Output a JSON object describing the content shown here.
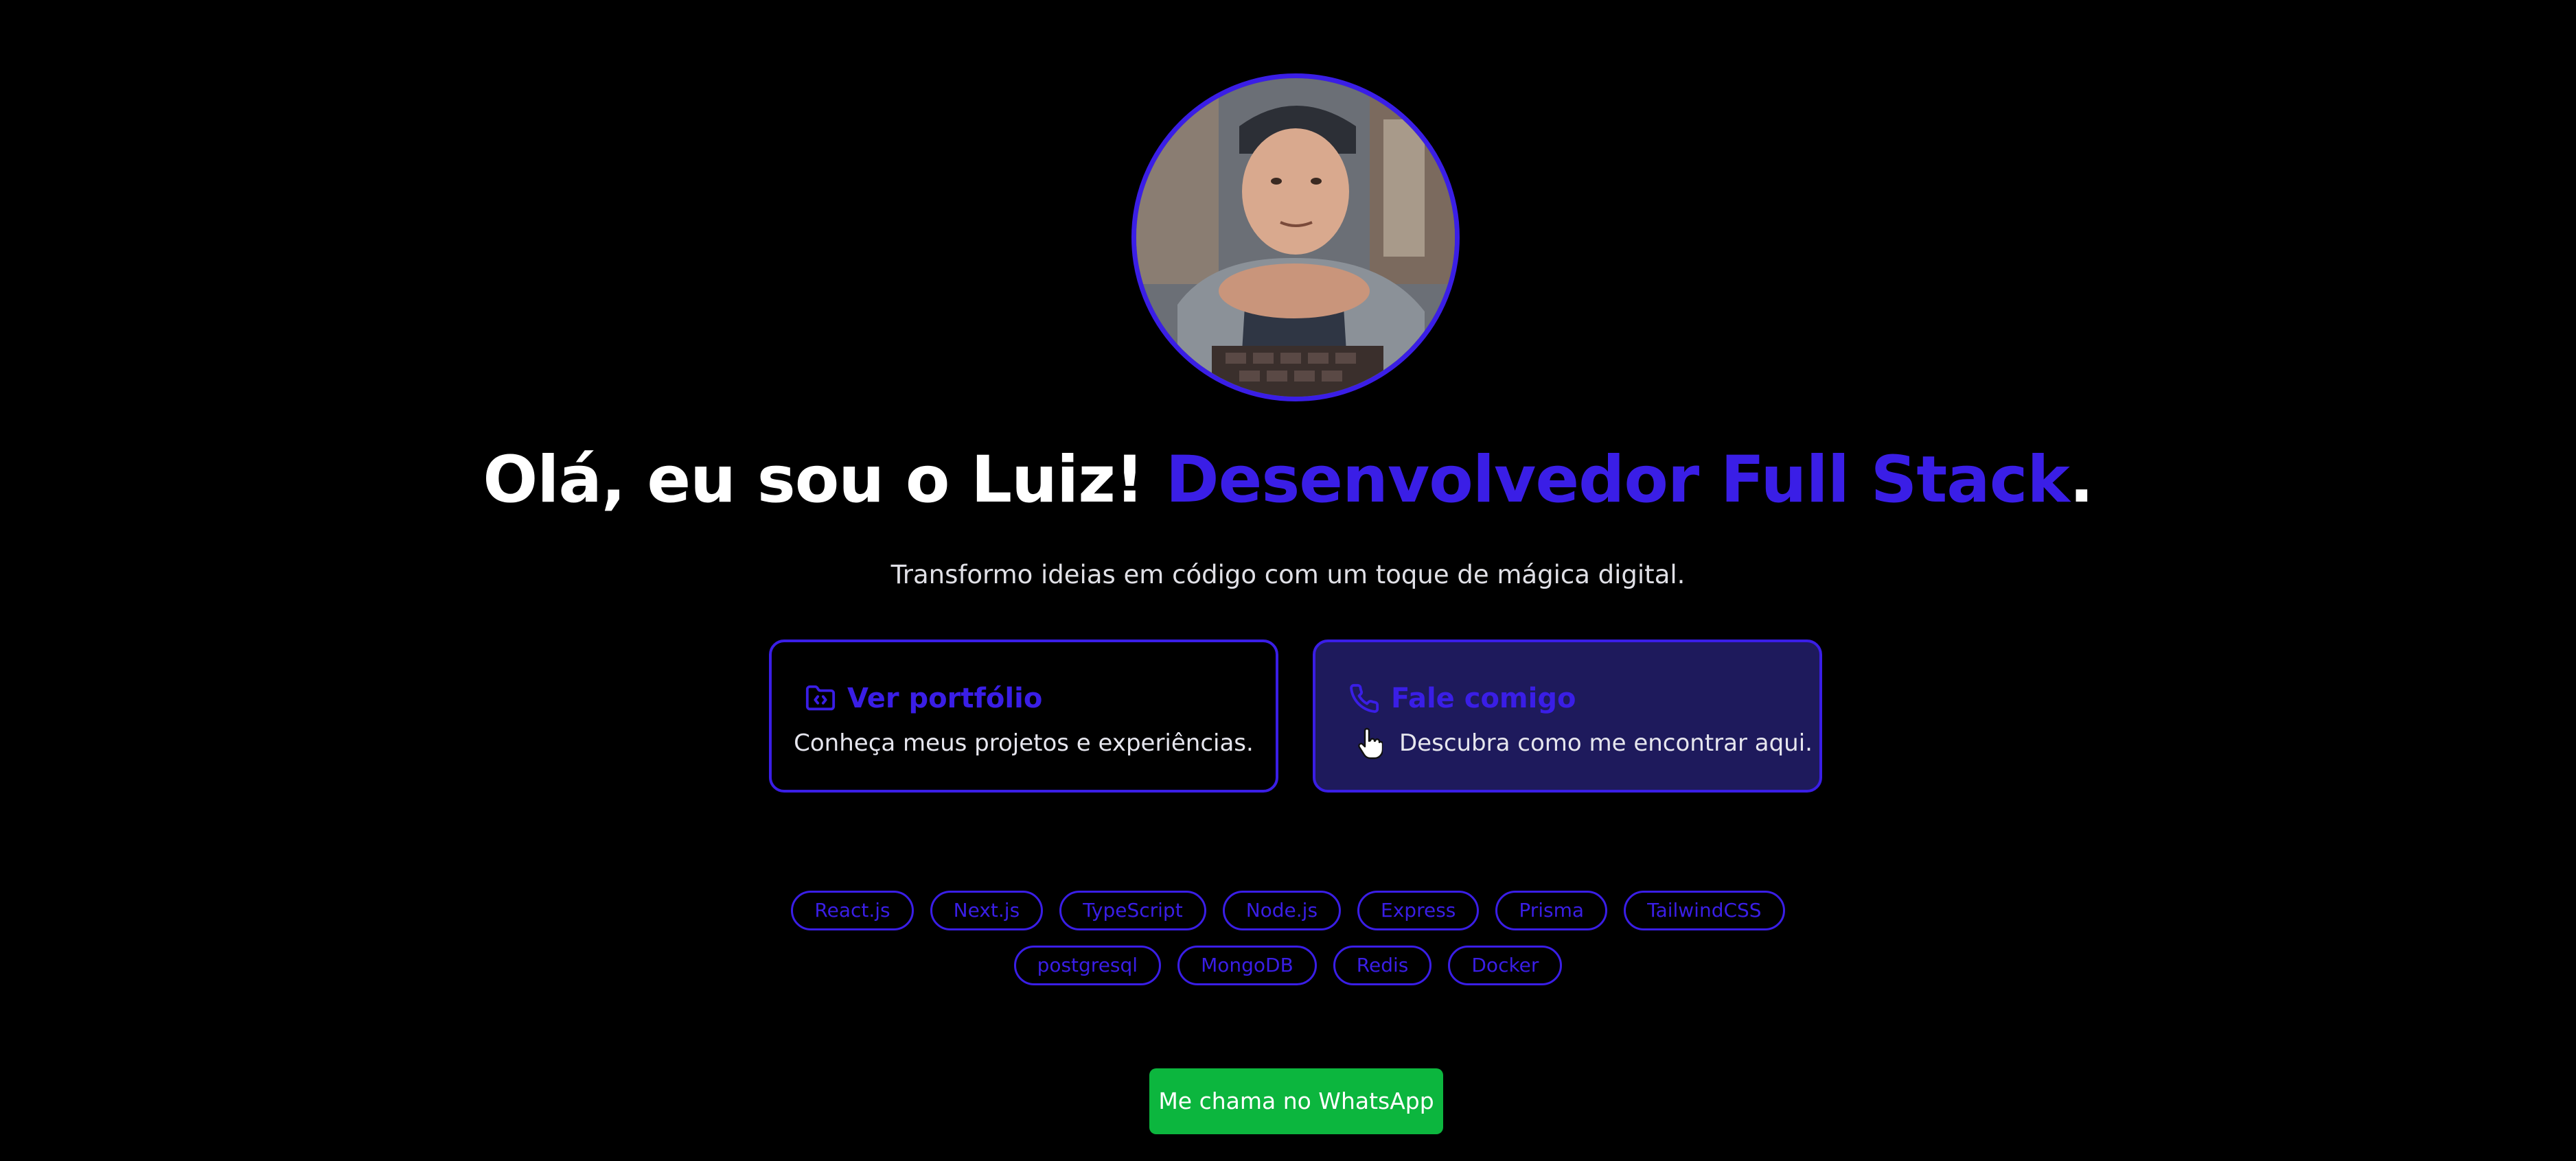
{
  "hero": {
    "greeting": "Olá, eu sou o Luiz! ",
    "role": "Desenvolvedor Full Stack",
    "period": ".",
    "subtitle": "Transformo ideias em código com um toque de mágica digital."
  },
  "cards": [
    {
      "icon": "folder-code-icon",
      "title": "Ver portfólio",
      "description": "Conheça meus projetos e experiências."
    },
    {
      "icon": "phone-icon",
      "title": "Fale comigo",
      "description": "Descubra como me encontrar aqui."
    }
  ],
  "tags": {
    "row1": [
      "React.js",
      "Next.js",
      "TypeScript",
      "Node.js",
      "Express",
      "Prisma",
      "TailwindCSS"
    ],
    "row2": [
      "postgresql",
      "MongoDB",
      "Redis",
      "Docker"
    ]
  },
  "whatsapp_button": "Me chama no WhatsApp",
  "colors": {
    "background": "#000000",
    "accent": "#3a1ee6",
    "contact_card_bg": "#1e1a5c",
    "whatsapp_green": "#0cb63e",
    "text": "#ffffff"
  }
}
